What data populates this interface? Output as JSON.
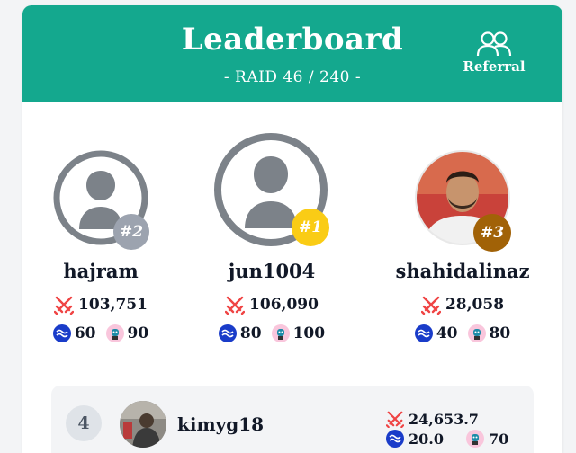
{
  "header": {
    "title": "Leaderboard",
    "subtitle": "- RAID 46 / 240 -",
    "referral_label": "Referral",
    "bg_color": "#14a88e"
  },
  "podium": [
    {
      "rank": "#2",
      "username": "hajram",
      "damage": "103,751",
      "steem": "60",
      "pets": "90",
      "badge_color": "#9ca3af",
      "avatar": "default"
    },
    {
      "rank": "#1",
      "username": "jun1004",
      "damage": "106,090",
      "steem": "80",
      "pets": "100",
      "badge_color": "#facc15",
      "avatar": "default"
    },
    {
      "rank": "#3",
      "username": "shahidalinaz",
      "damage": "28,058",
      "steem": "40",
      "pets": "80",
      "badge_color": "#a16207",
      "avatar": "photo"
    }
  ],
  "list": [
    {
      "rank": "4",
      "username": "kimyg18",
      "damage": "24,653.7",
      "steem": "20.0",
      "pets": "70",
      "avatar": "photo"
    }
  ],
  "icons": {
    "damage": "crossed-swords-icon",
    "steem": "steem-coin-icon",
    "pets": "pet-icon",
    "referral": "users-icon"
  }
}
